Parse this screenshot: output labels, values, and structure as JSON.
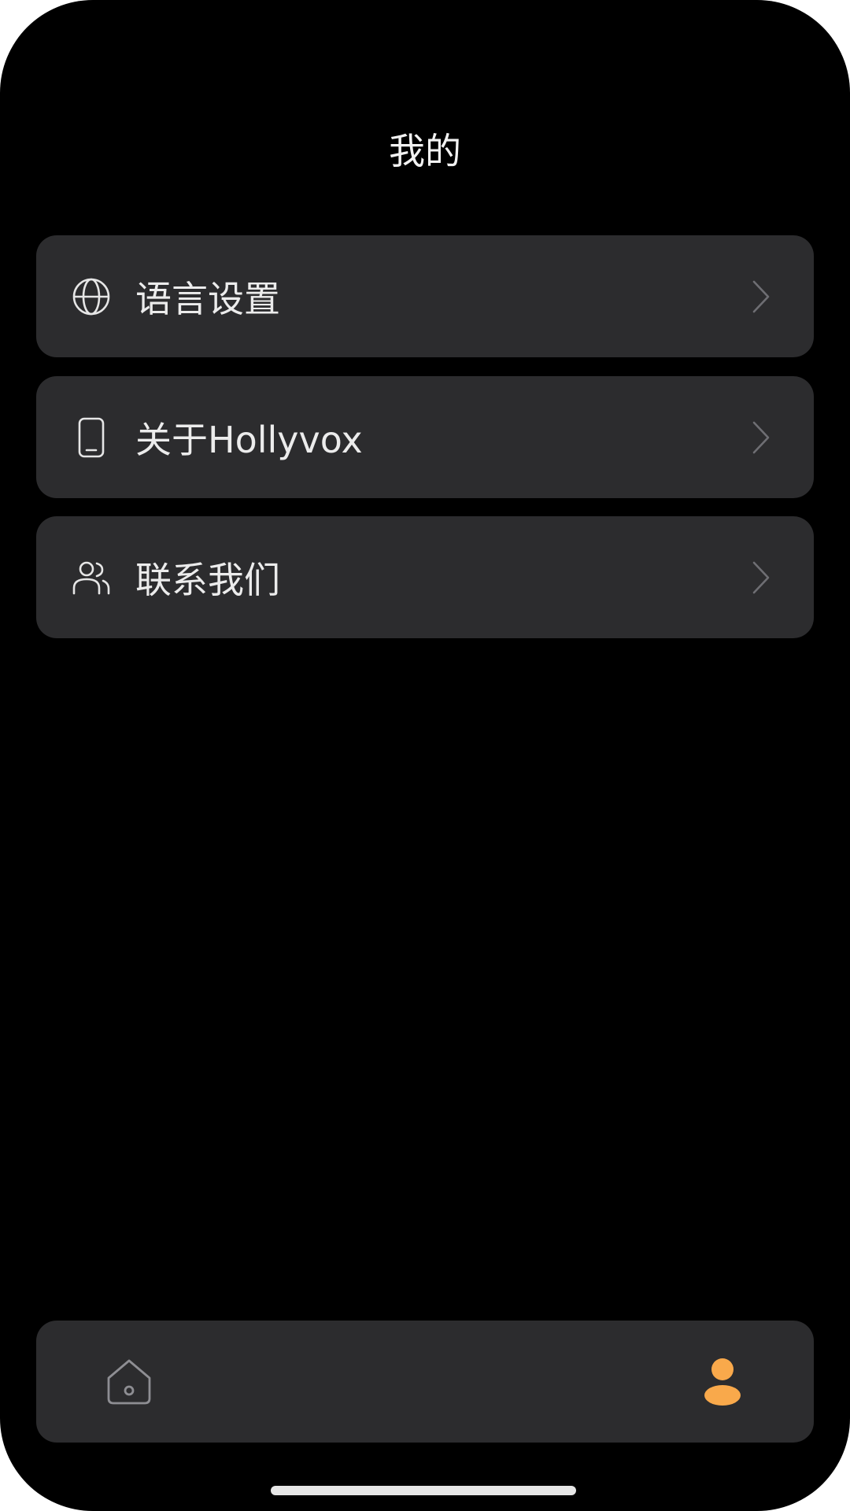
{
  "header": {
    "title": "我的"
  },
  "menu": {
    "items": [
      {
        "label": "语言设置",
        "icon": "globe-icon"
      },
      {
        "label": "关于Hollyvox",
        "icon": "phone-icon"
      },
      {
        "label": "联系我们",
        "icon": "users-icon"
      }
    ]
  },
  "tabbar": {
    "tabs": [
      {
        "icon": "home-icon",
        "active": false
      },
      {
        "icon": "profile-icon",
        "active": true
      }
    ]
  },
  "colors": {
    "background": "#000000",
    "card": "#2c2c2e",
    "text": "#ececec",
    "accent": "#f9a94b",
    "inactive_icon": "#8e8e93"
  }
}
